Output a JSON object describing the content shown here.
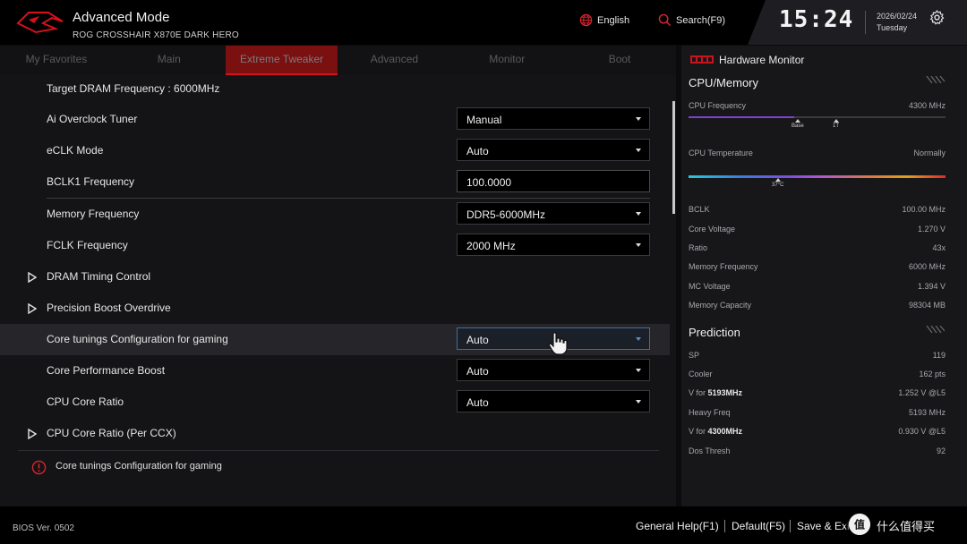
{
  "header": {
    "title": "Advanced Mode",
    "subtitle": "ROG CROSSHAIR X870E DARK HERO",
    "language": "English",
    "search": "Search(F9)",
    "time": "15:24",
    "date": "2026/02/24",
    "weekday": "Tuesday"
  },
  "tabs": [
    {
      "label": "My Favorites",
      "active": false
    },
    {
      "label": "Main",
      "active": false
    },
    {
      "label": "Extreme Tweaker",
      "active": true
    },
    {
      "label": "Advanced",
      "active": false
    },
    {
      "label": "Monitor",
      "active": false
    },
    {
      "label": "Boot",
      "active": false
    }
  ],
  "settings": {
    "target_dram": "Target DRAM Frequency : 6000MHz",
    "ai_oc": {
      "label": "Ai Overclock Tuner",
      "value": "Manual"
    },
    "eclk": {
      "label": "eCLK Mode",
      "value": "Auto"
    },
    "bclk1": {
      "label": "BCLK1 Frequency",
      "value": "100.0000"
    },
    "mem_freq": {
      "label": "Memory Frequency",
      "value": "DDR5-6000MHz"
    },
    "fclk": {
      "label": "FCLK Frequency",
      "value": "2000 MHz"
    },
    "dram_timing": {
      "label": "DRAM Timing Control"
    },
    "pbo": {
      "label": "Precision Boost Overdrive"
    },
    "core_tunings": {
      "label": "Core tunings Configuration for gaming",
      "value": "Auto"
    },
    "cpb": {
      "label": "Core Performance Boost",
      "value": "Auto"
    },
    "cpu_ratio": {
      "label": "CPU Core Ratio",
      "value": "Auto"
    },
    "cpu_ratio_ccx": {
      "label": "CPU Core Ratio (Per CCX)"
    }
  },
  "help_text": "Core tunings Configuration for gaming",
  "hardware_monitor": {
    "title": "Hardware Monitor",
    "cpu_memory": {
      "title": "CPU/Memory",
      "cpu_freq_label": "CPU Frequency",
      "cpu_freq_value": "4300 MHz",
      "cpu_freq_fill": 0.41,
      "marker_base": "Base",
      "marker_1t": "1T",
      "cpu_temp_label": "CPU Temperature",
      "cpu_temp_status": "Normally",
      "cpu_temp_marker": "37°C",
      "stats": [
        {
          "k": "BCLK",
          "v": "100.00 MHz"
        },
        {
          "k": "Core Voltage",
          "v": "1.270 V"
        },
        {
          "k": "Ratio",
          "v": "43x"
        },
        {
          "k": "Memory Frequency",
          "v": "6000 MHz"
        },
        {
          "k": "MC Voltage",
          "v": "1.394 V"
        },
        {
          "k": "Memory Capacity",
          "v": "98304 MB"
        }
      ]
    },
    "prediction": {
      "title": "Prediction",
      "sp": {
        "k": "SP",
        "v": "119"
      },
      "cooler": {
        "k": "Cooler",
        "v": "162 pts"
      },
      "v1": {
        "prefix": "V for ",
        "freq": "5193MHz",
        "v": "1.252 V @L5"
      },
      "heavy": {
        "k": "Heavy Freq",
        "v": "5193 MHz"
      },
      "v2": {
        "prefix": "V for ",
        "freq": "4300MHz",
        "v": "0.930 V @L5"
      },
      "dos": {
        "k": "Dos Thresh",
        "v": "92"
      }
    }
  },
  "footer": {
    "bios_version": "BIOS Ver. 0502",
    "general_help": "General Help(F1)",
    "default": "Default(F5)",
    "save_exit": "Save & Exi",
    "watermark": "什么值得买"
  },
  "colors": {
    "accent": "#d6111a",
    "tab_active_bg": "#7a1010",
    "freq_bar": "#7f3fd0"
  }
}
